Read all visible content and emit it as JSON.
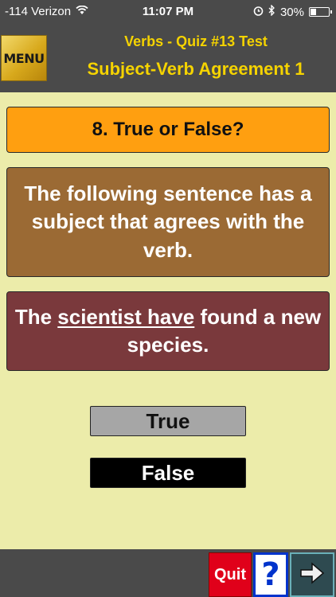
{
  "status": {
    "carrier": "-114 Verizon",
    "time": "11:07 PM",
    "battery": "30%",
    "battery_level": 0.3
  },
  "header": {
    "menu_label": "MENU",
    "subtitle": "Verbs - Quiz #13 Test",
    "title": "Subject-Verb Agreement 1"
  },
  "question": {
    "number_label": "8. True or False?",
    "prompt": "The following sentence has a subject that agrees with the verb.",
    "sentence": {
      "before": "The ",
      "underlined": "scientist have",
      "after": " found a new species."
    }
  },
  "answers": {
    "true_label": "True",
    "false_label": "False"
  },
  "bottom": {
    "quit_label": "Quit",
    "help_label": "?"
  },
  "icons": [
    "wifi-icon",
    "alarm-icon",
    "bluetooth-icon",
    "battery-icon",
    "arrow-right-icon"
  ],
  "colors": {
    "background": "#ececaa",
    "header": "#4a4a4a",
    "title_yellow": "#f5d300",
    "question_orange": "#ff9f10",
    "prompt_brown": "#9b6a34",
    "sentence_maroon": "#7a393c",
    "quit_red": "#e0001a",
    "help_blue": "#0033cc"
  }
}
